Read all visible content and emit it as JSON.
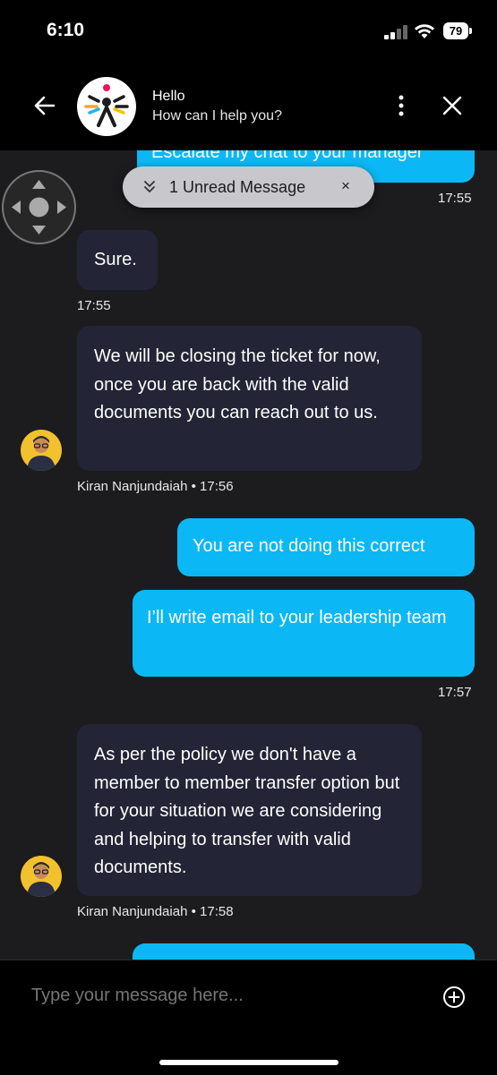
{
  "status": {
    "time": "6:10",
    "battery": "79"
  },
  "header": {
    "title": "Hello",
    "subtitle": "How can I help you?"
  },
  "unread_banner": {
    "label": "1 Unread Message",
    "dismiss": "×"
  },
  "messages": [
    {
      "sender": "user",
      "text": "Escalate my chat to your manager",
      "time": "17:55"
    },
    {
      "sender": "agent",
      "text": "Sure.",
      "time": "17:55"
    },
    {
      "sender": "agent",
      "text": "We will be closing the ticket for now, once you are back with the valid documents you can reach out to us.",
      "name": "Kiran Nanjundaiah",
      "separator": "•",
      "time": "17:56"
    },
    {
      "sender": "user",
      "text": "You are not doing this correct"
    },
    {
      "sender": "user",
      "text": "I’ll write email to your leadership team",
      "time": "17:57"
    },
    {
      "sender": "agent",
      "text": "As per the policy we don't have a member to member transfer option but for  your situation we are considering and helping to transfer with valid documents.",
      "name": "Kiran Nanjundaiah",
      "separator": "•",
      "time": "17:58"
    }
  ],
  "composer": {
    "placeholder": "Type your message here..."
  },
  "colors": {
    "user_bubble": "#0bb8f5",
    "agent_bubble": "#232536",
    "background": "#1c1c1e",
    "avatar": "#f2c12e"
  },
  "icons": [
    "back-arrow-icon",
    "brand-logo",
    "more-vertical-icon",
    "close-icon",
    "chevron-double-down-icon",
    "dpad-icon",
    "plus-circle-icon"
  ]
}
